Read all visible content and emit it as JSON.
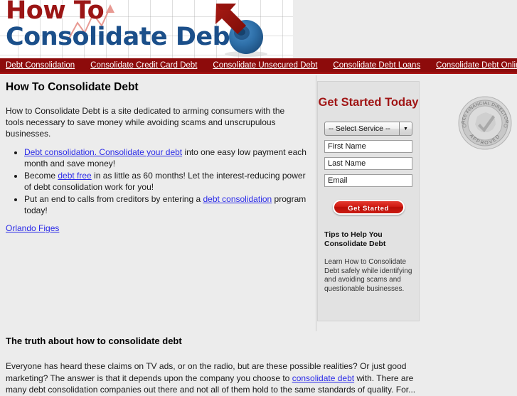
{
  "header": {
    "logo_line1": "How To",
    "logo_line2": "Consolidate Debt",
    "logo_colors": {
      "line1": "#9b1515",
      "line2": "#1b4f8a",
      "arrow": "#9b1515",
      "sphere": "#2a6ca8"
    }
  },
  "nav": {
    "background": "#8d0b0b",
    "items": [
      {
        "label": "Debt Consolidation"
      },
      {
        "label": "Consolidate Credit Card Debt"
      },
      {
        "label": "Consolidate Unsecured Debt"
      },
      {
        "label": "Consolidate Debt Loans"
      },
      {
        "label": "Consolidate Debt Online"
      }
    ]
  },
  "main": {
    "title": "How To Consolidate Debt",
    "intro": "How to Consolidate Debt is a site dedicated to arming consumers with the tools necessary to save money while avoiding scams and unscrupulous businesses.",
    "bullets": [
      {
        "link": "Debt consolidation. Consolidate your debt",
        "rest": " into one easy low payment each month and save money!"
      },
      {
        "pre": "Become ",
        "link": "debt free",
        "rest": " in as little as 60 months! Let the interest-reducing power of debt consolidation work for you!"
      },
      {
        "pre": "Put an end to calls from creditors by entering a ",
        "link": "debt consolidation",
        "rest": " program today!"
      }
    ],
    "byline": "Orlando Figes"
  },
  "bottom": {
    "title": "The truth about how to consolidate debt",
    "pre": "Everyone has heard these claims on TV ads, or on the radio, but are these possible realities? Or just good marketing? The answer is that it depends upon the company you choose to ",
    "link": "consolidate debt",
    "post": " with. There are many debt consolidation companies out there and not all of them hold to the same standards of quality. For..."
  },
  "sidebar": {
    "title": "Get Started Today",
    "title_color": "#a01515",
    "select": {
      "selected": "-- Select Service --",
      "arrow": "▼"
    },
    "fields": [
      {
        "name": "first-name",
        "placeholder": "First Name",
        "value": ""
      },
      {
        "name": "last-name",
        "placeholder": "Last Name",
        "value": ""
      },
      {
        "name": "email",
        "placeholder": "Email",
        "value": ""
      }
    ],
    "submit_label": "Get Started",
    "submit_color": "#c7150c",
    "tips_heading": "Tips to Help You Consolidate Debt",
    "tips_body": "Learn How to Consolidate Debt safely while identifying and avoiding scams and questionable businesses."
  },
  "seal": {
    "arc_text": "FREE FINANCIAL DIRECTORY",
    "bottom_text": "APPROVED",
    "icon": "checkmark-icon"
  }
}
